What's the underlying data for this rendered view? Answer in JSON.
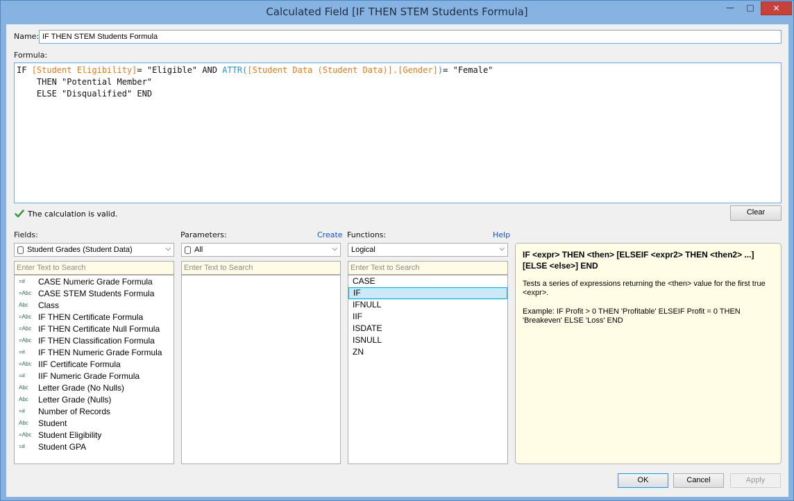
{
  "window": {
    "title": "Calculated Field [IF THEN STEM Students Formula]",
    "minimize_glyph": "—",
    "maximize_glyph": "□",
    "close_glyph": "✕"
  },
  "name_field": {
    "label": "Name:",
    "value": "IF THEN STEM Students Formula"
  },
  "formula": {
    "label": "Formula:",
    "tokens": {
      "if": "IF ",
      "field_eligibility": "[Student Eligibility]",
      "eq1": "= \"Eligible\" AND ",
      "attr_fn": "ATTR",
      "paren_open": "(",
      "field_gender": "[Student Data (Student Data)].[Gender]",
      "paren_close": ")",
      "eq2": "= \"Female\"",
      "line2": "    THEN \"Potential Member\"",
      "line3": "    ELSE \"Disqualified\" END"
    }
  },
  "status": {
    "valid_text": "The calculation is valid.",
    "clear_label": "Clear"
  },
  "fields": {
    "label": "Fields:",
    "source": "Student Grades (Student Data)",
    "search_placeholder": "Enter Text to Search",
    "items": [
      {
        "type": "=#",
        "name": "CASE Numeric Grade Formula"
      },
      {
        "type": "=Abc",
        "name": "CASE STEM Students Formula"
      },
      {
        "type": "Abc",
        "name": "Class"
      },
      {
        "type": "=Abc",
        "name": "IF THEN Certificate Formula"
      },
      {
        "type": "=Abc",
        "name": "IF THEN Certificate Null Formula"
      },
      {
        "type": "=Abc",
        "name": "IF THEN Classification Formula"
      },
      {
        "type": "=#",
        "name": "IF THEN Numeric Grade Formula"
      },
      {
        "type": "=Abc",
        "name": "IIF Certificate Formula"
      },
      {
        "type": "=#",
        "name": "IIF Numeric Grade Formula"
      },
      {
        "type": "Abc",
        "name": "Letter Grade (No Nulls)"
      },
      {
        "type": "Abc",
        "name": "Letter Grade (Nulls)"
      },
      {
        "type": "=#",
        "name": "Number of Records"
      },
      {
        "type": "Abc",
        "name": "Student"
      },
      {
        "type": "=Abc",
        "name": "Student Eligibility"
      },
      {
        "type": "=#",
        "name": "Student GPA"
      }
    ]
  },
  "parameters": {
    "label": "Parameters:",
    "create_link": "Create",
    "filter": "All",
    "search_placeholder": "Enter Text to Search"
  },
  "functions": {
    "label": "Functions:",
    "help_link": "Help",
    "category": "Logical",
    "search_placeholder": "Enter Text to Search",
    "items": [
      "CASE",
      "IF",
      "IFNULL",
      "IIF",
      "ISDATE",
      "ISNULL",
      "ZN"
    ],
    "selected": "IF"
  },
  "help": {
    "title": "IF <expr> THEN <then> [ELSEIF <expr2> THEN <then2> ...] [ELSE <else>] END",
    "description": "Tests a series of expressions returning the <then> value for the first true <expr>.",
    "example": "Example: IF Profit > 0 THEN 'Profitable' ELSEIF Profit = 0 THEN 'Breakeven' ELSE 'Loss' END"
  },
  "buttons": {
    "ok": "OK",
    "cancel": "Cancel",
    "apply": "Apply"
  },
  "colors": {
    "field_token": "#e07a1f",
    "function_token": "#2b8fce",
    "valid_check": "#3a9a3a",
    "selected_row": "#cde8f7"
  }
}
